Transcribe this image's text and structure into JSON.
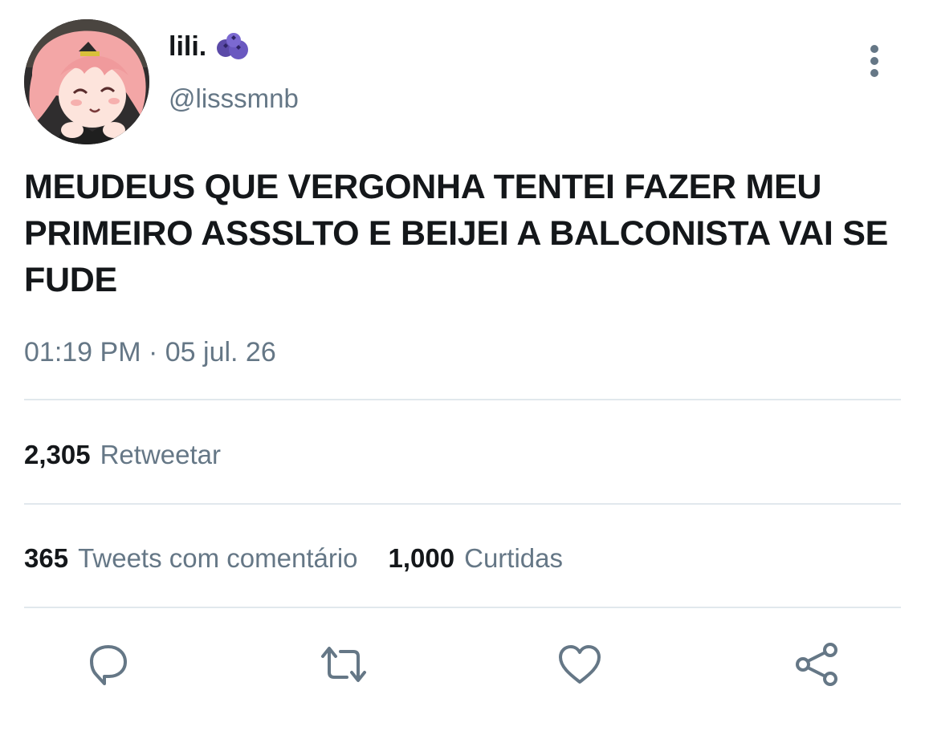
{
  "user": {
    "display_name": "lili.",
    "handle": "@lisssmnb",
    "name_emoji": "blueberries-emoji",
    "avatar": "anime-girl-avatar"
  },
  "tweet": {
    "text": "MEUDEUS QUE VERGONHA TENTEI FAZER MEU PRIMEIRO ASSSLTO E BEIJEI A BALCONISTA VAI SE FUDE",
    "timestamp": "01:19 PM · 05 jul. 26"
  },
  "stats": {
    "retweets": {
      "count": "2,305",
      "label": "Retweetar"
    },
    "quotes": {
      "count": "365",
      "label": "Tweets com comentário"
    },
    "likes": {
      "count": "1,000",
      "label": "Curtidas"
    }
  },
  "actions": [
    "reply-icon",
    "retweet-icon",
    "like-icon",
    "share-icon"
  ],
  "colors": {
    "text": "#14171a",
    "secondary": "#657786",
    "divider": "#e1e8ed",
    "background": "#ffffff"
  }
}
